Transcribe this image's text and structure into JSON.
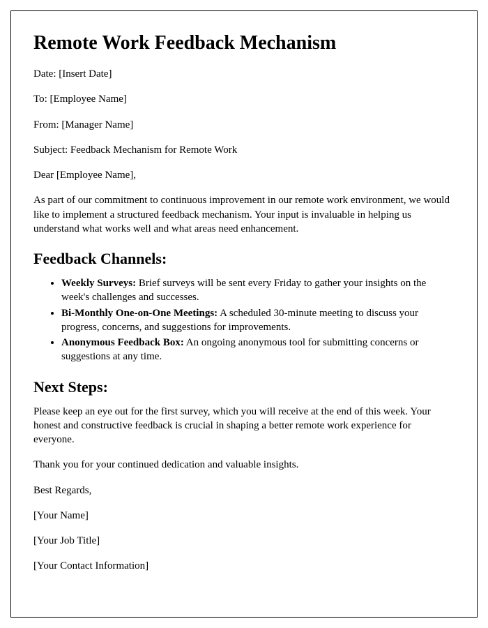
{
  "title": "Remote Work Feedback Mechanism",
  "meta": {
    "date": "Date: [Insert Date]",
    "to": "To: [Employee Name]",
    "from": "From: [Manager Name]",
    "subject": "Subject: Feedback Mechanism for Remote Work"
  },
  "salutation": "Dear [Employee Name],",
  "intro": "As part of our commitment to continuous improvement in our remote work environment, we would like to implement a structured feedback mechanism. Your input is invaluable in helping us understand what works well and what areas need enhancement.",
  "section1_heading": "Feedback Channels:",
  "channels": [
    {
      "label": "Weekly Surveys:",
      "text": " Brief surveys will be sent every Friday to gather your insights on the week's challenges and successes."
    },
    {
      "label": "Bi-Monthly One-on-One Meetings:",
      "text": " A scheduled 30-minute meeting to discuss your progress, concerns, and suggestions for improvements."
    },
    {
      "label": "Anonymous Feedback Box:",
      "text": " An ongoing anonymous tool for submitting concerns or suggestions at any time."
    }
  ],
  "section2_heading": "Next Steps:",
  "next_steps": "Please keep an eye out for the first survey, which you will receive at the end of this week. Your honest and constructive feedback is crucial in shaping a better remote work experience for everyone.",
  "thanks": "Thank you for your continued dedication and valuable insights.",
  "closing": "Best Regards,",
  "signature": {
    "name": "[Your Name]",
    "title": "[Your Job Title]",
    "contact": "[Your Contact Information]"
  }
}
